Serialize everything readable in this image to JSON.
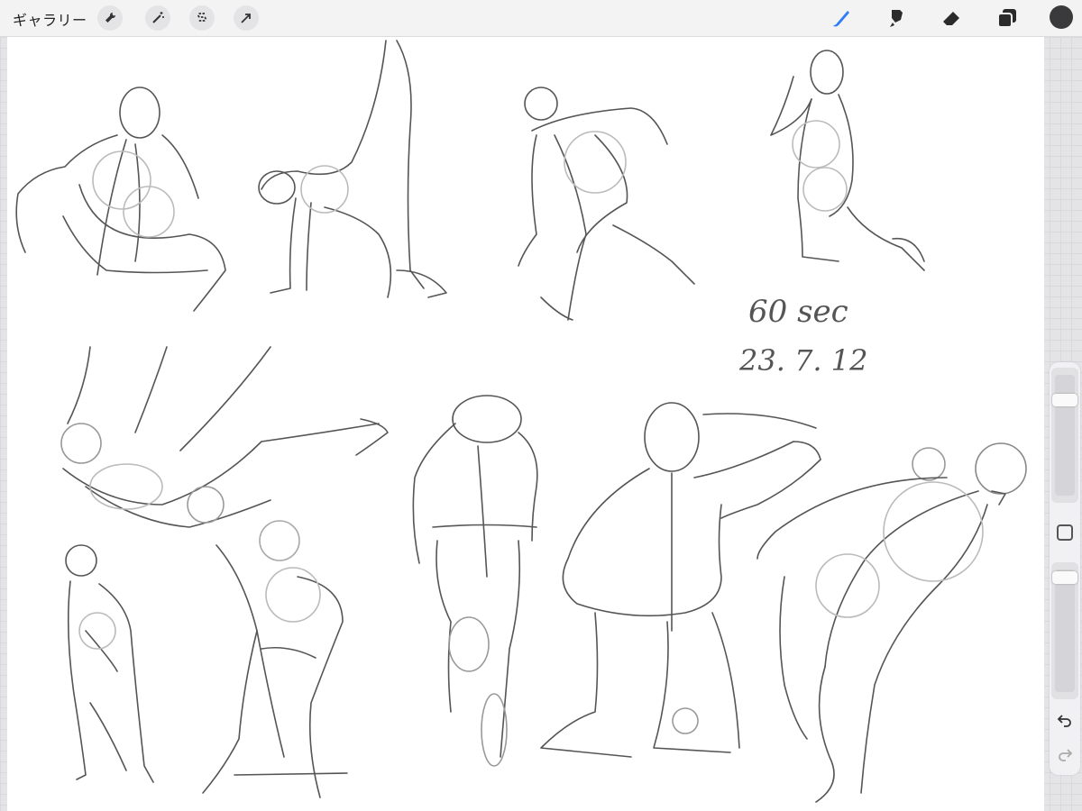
{
  "toolbar": {
    "gallery_label": "ギャラリー",
    "left_tools": [
      {
        "name": "actions",
        "icon": "wrench-icon"
      },
      {
        "name": "adjustments",
        "icon": "magic-wand-icon"
      },
      {
        "name": "selection",
        "icon": "selection-s-icon"
      },
      {
        "name": "transform",
        "icon": "arrow-icon"
      }
    ],
    "right_tools": [
      {
        "name": "brush",
        "icon": "brush-icon",
        "active": true
      },
      {
        "name": "smudge",
        "icon": "smudge-icon",
        "active": false
      },
      {
        "name": "eraser",
        "icon": "eraser-icon",
        "active": false
      },
      {
        "name": "layers",
        "icon": "layers-icon",
        "active": false
      }
    ],
    "current_color": "#3a3a3c",
    "accent_color": "#2f7cf6"
  },
  "sidebar": {
    "brush_size_level": 0.18,
    "brush_opacity_level": 0.03,
    "modify_icon": "square-icon",
    "undo_icon": "undo-icon",
    "redo_icon": "redo-icon",
    "redo_enabled": false
  },
  "canvas": {
    "note_line1": "60 sec",
    "note_line2": "23. 7. 12"
  }
}
